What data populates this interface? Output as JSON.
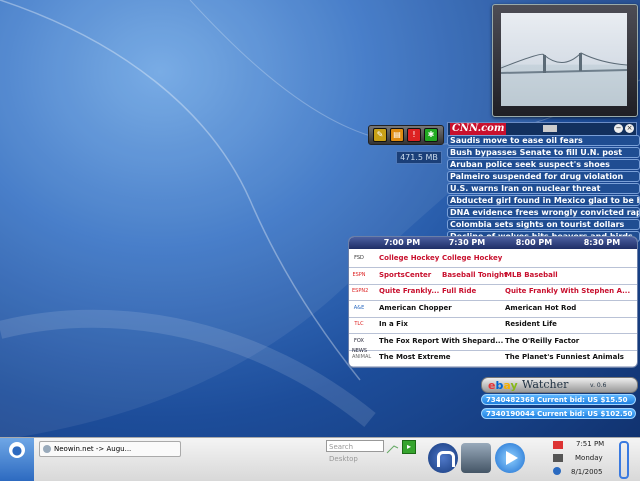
{
  "photo": {
    "name": "photo-widget"
  },
  "dock": {
    "memory": "471.5 MB"
  },
  "cnn": {
    "logo": "CNN.com",
    "headlines": [
      "Saudis move to ease oil fears",
      "Bush bypasses Senate to fill U.N. post",
      "Aruban police seek suspect's shoes",
      "Palmeiro suspended for drug violation",
      "U.S. warns Iran on nuclear threat",
      "Abducted girl found in Mexico glad to be home",
      "DNA evidence frees wrongly convicted rapist",
      "Colombia sets sights on tourist dollars",
      "Decline of wolves hits beavers and birds, study"
    ]
  },
  "tv": {
    "times": [
      "7:00 PM",
      "7:30 PM",
      "8:00 PM",
      "8:30 PM"
    ],
    "rows": [
      {
        "logo": "FSD",
        "progs": [
          "College Hockey",
          "College Hockey",
          "",
          ""
        ],
        "red": true
      },
      {
        "logo": "ESPN",
        "progs": [
          "SportsCenter",
          "Baseball Tonight",
          "MLB Baseball",
          ""
        ],
        "red": true
      },
      {
        "logo": "ESPN2",
        "progs": [
          "Quite Frankly...",
          "Full Ride",
          "Quite Frankly With Stephen A...",
          ""
        ],
        "red": true
      },
      {
        "logo": "A&E",
        "progs": [
          "American Chopper",
          "",
          "American Hot Rod",
          ""
        ],
        "red": false
      },
      {
        "logo": "TLC",
        "progs": [
          "In a Fix",
          "",
          "Resident Life",
          ""
        ],
        "red": false
      },
      {
        "logo": "FOX NEWS",
        "progs": [
          "The Fox Report With Shepard...",
          "",
          "The O'Reilly Factor",
          ""
        ],
        "red": false
      },
      {
        "logo": "ANIMAL",
        "progs": [
          "The Most Extreme",
          "",
          "The Planet's Funniest Animals",
          ""
        ],
        "red": false
      }
    ]
  },
  "ebay": {
    "title": "Watcher",
    "version": "v. 0.6",
    "bids": [
      "7340482368  Current bid: US $15.50",
      "7340190044  Current bid: US $102.50"
    ]
  },
  "taskbar": {
    "task": "Neowin.net -> Augu...",
    "search_placeholder": "Search Desktop",
    "time": "7:51 PM",
    "day": "Monday",
    "date": "8/1/2005"
  }
}
